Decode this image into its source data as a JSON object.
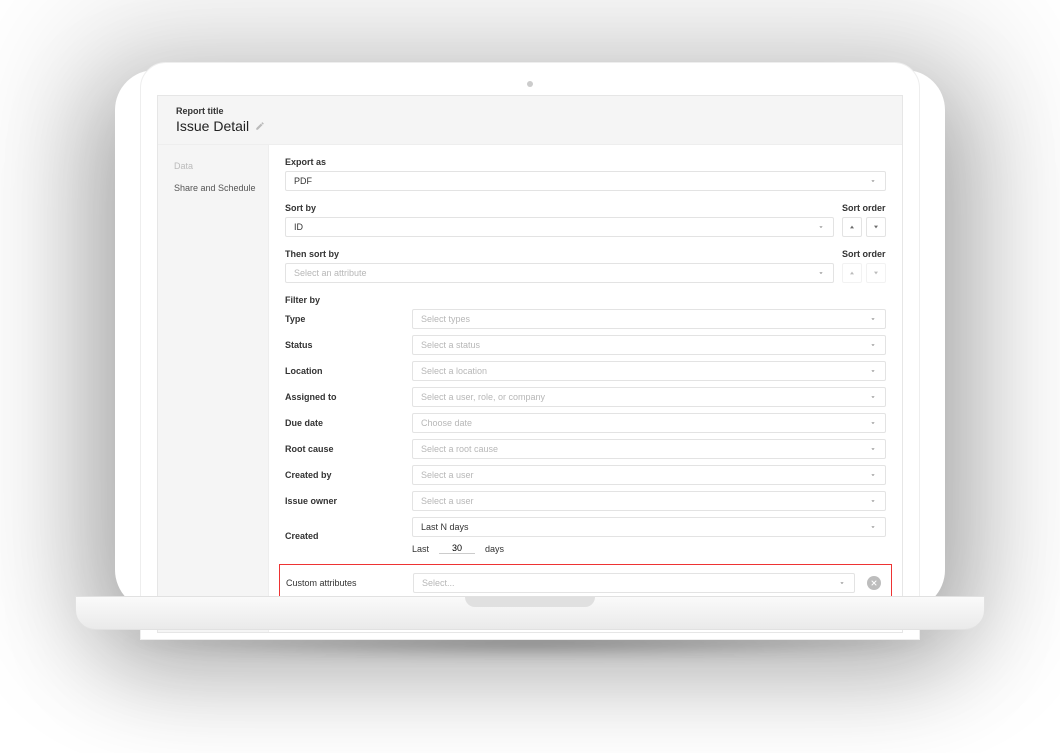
{
  "header": {
    "label": "Report title",
    "title": "Issue Detail"
  },
  "sidebar": {
    "items": [
      {
        "label": "Data",
        "active": false,
        "muted": true
      },
      {
        "label": "Share and Schedule",
        "active": false,
        "muted": false
      }
    ]
  },
  "export": {
    "label": "Export as",
    "value": "PDF"
  },
  "sort": {
    "label": "Sort by",
    "value": "ID",
    "order_label": "Sort order"
  },
  "then_sort": {
    "label": "Then sort by",
    "placeholder": "Select an attribute",
    "order_label": "Sort order"
  },
  "filter": {
    "label": "Filter by",
    "rows": [
      {
        "label": "Type",
        "placeholder": "Select types"
      },
      {
        "label": "Status",
        "placeholder": "Select a status"
      },
      {
        "label": "Location",
        "placeholder": "Select a location"
      },
      {
        "label": "Assigned to",
        "placeholder": "Select a user, role, or company"
      },
      {
        "label": "Due date",
        "placeholder": "Choose date"
      },
      {
        "label": "Root cause",
        "placeholder": "Select a root cause"
      },
      {
        "label": "Created by",
        "placeholder": "Select a user"
      },
      {
        "label": "Issue owner",
        "placeholder": "Select a user"
      }
    ],
    "created": {
      "label": "Created",
      "value": "Last N days",
      "lastn": {
        "prefix": "Last",
        "value": "30",
        "suffix": "days"
      }
    }
  },
  "custom": {
    "label": "Custom attributes",
    "placeholder": "Select..."
  }
}
